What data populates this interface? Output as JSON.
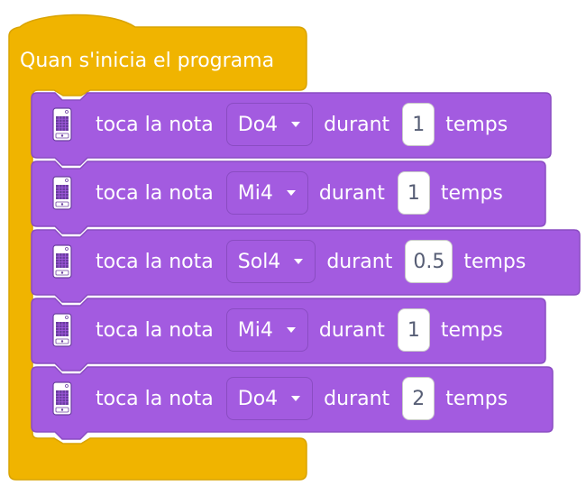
{
  "hat": {
    "label": "Quan s'inicia el programa",
    "color": "#f0b400"
  },
  "block_color": "#a35be0",
  "block_border": "#8a4cc2",
  "blocks": [
    {
      "verb": "toca la nota",
      "note": "Do4",
      "for_label": "durant",
      "beats": "1",
      "unit": "temps"
    },
    {
      "verb": "toca la nota",
      "note": "Mi4",
      "for_label": "durant",
      "beats": "1",
      "unit": "temps"
    },
    {
      "verb": "toca la nota",
      "note": "Sol4",
      "for_label": "durant",
      "beats": "0.5",
      "unit": "temps"
    },
    {
      "verb": "toca la nota",
      "note": "Mi4",
      "for_label": "durant",
      "beats": "1",
      "unit": "temps"
    },
    {
      "verb": "toca la nota",
      "note": "Do4",
      "for_label": "durant",
      "beats": "2",
      "unit": "temps"
    }
  ],
  "icons": {
    "device": "microbit-device-icon",
    "dropdown": "dropdown-arrow-icon"
  }
}
